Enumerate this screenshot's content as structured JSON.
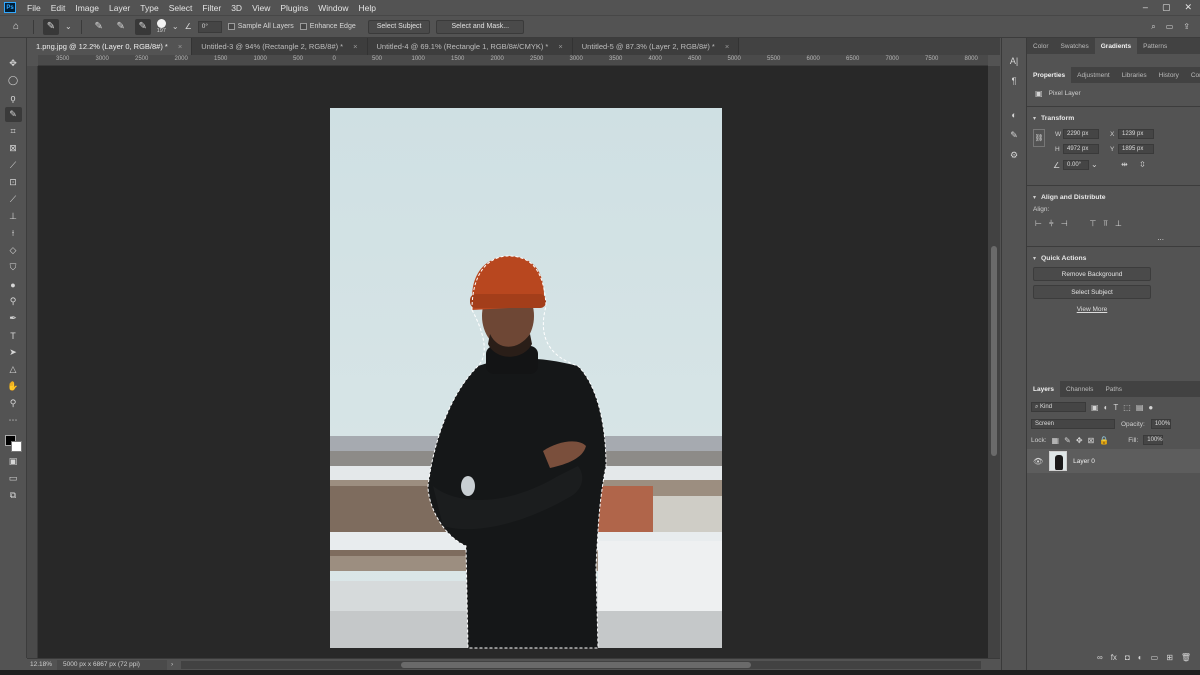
{
  "menu": {
    "logo": "Ps",
    "items": [
      "File",
      "Edit",
      "Image",
      "Layer",
      "Type",
      "Select",
      "Filter",
      "3D",
      "View",
      "Plugins",
      "Window",
      "Help"
    ]
  },
  "options": {
    "brush_size": "197",
    "angle": "0°",
    "sample_all_layers": "Sample All Layers",
    "enhance_edge": "Enhance Edge",
    "select_subject": "Select Subject",
    "select_and_mask": "Select and Mask..."
  },
  "tabs": [
    {
      "label": "1.png.jpg @ 12.2% (Layer 0, RGB/8#) *",
      "close": "×"
    },
    {
      "label": "Untitled-3 @ 94% (Rectangle 2, RGB/8#) *",
      "close": "×"
    },
    {
      "label": "Untitled-4 @ 69.1% (Rectangle 1, RGB/8#/CMYK) *",
      "close": "×"
    },
    {
      "label": "Untitled-5 @ 87.3% (Layer 2, RGB/8#) *",
      "close": "×"
    }
  ],
  "ruler_h": [
    "3500",
    "3000",
    "2500",
    "2000",
    "1500",
    "1000",
    "500",
    "0",
    "500",
    "1000",
    "1500",
    "2000",
    "2500",
    "3000",
    "3500",
    "4000",
    "4500",
    "5000",
    "5500",
    "6000",
    "6500",
    "7000",
    "7500",
    "8000"
  ],
  "status": {
    "zoom": "12.18%",
    "doc_size": "5000 px x 6867 px (72 ppi)",
    "arrow": "›"
  },
  "panels": {
    "top_tabs": [
      "Color",
      "Swatches",
      "Gradients",
      "Patterns"
    ],
    "prop_tabs": [
      "Properties",
      "Adjustment",
      "Libraries",
      "History",
      "Comm"
    ],
    "pixel_layer": "Pixel Layer",
    "transform": {
      "title": "Transform",
      "w_label": "W",
      "w_value": "2290 px",
      "h_label": "H",
      "h_value": "4972 px",
      "x_label": "X",
      "x_value": "1239 px",
      "y_label": "Y",
      "y_value": "1895 px",
      "angle": "0.00°"
    },
    "align": {
      "title": "Align and Distribute",
      "label": "Align:",
      "more": "..."
    },
    "quick_actions": {
      "title": "Quick Actions",
      "remove_bg": "Remove Background",
      "select_subject": "Select Subject",
      "view_more": "View More"
    },
    "layers_tabs": [
      "Layers",
      "Channels",
      "Paths"
    ],
    "layers": {
      "kind": "Kind",
      "blend_mode": "Screen",
      "opacity_label": "Opacity:",
      "opacity_value": "100%",
      "lock_label": "Lock:",
      "fill_label": "Fill:",
      "fill_value": "100%",
      "layer_name": "Layer 0"
    }
  },
  "colors": {
    "accent": "#31a8ff",
    "background": "#535353",
    "canvas": "#282828"
  }
}
